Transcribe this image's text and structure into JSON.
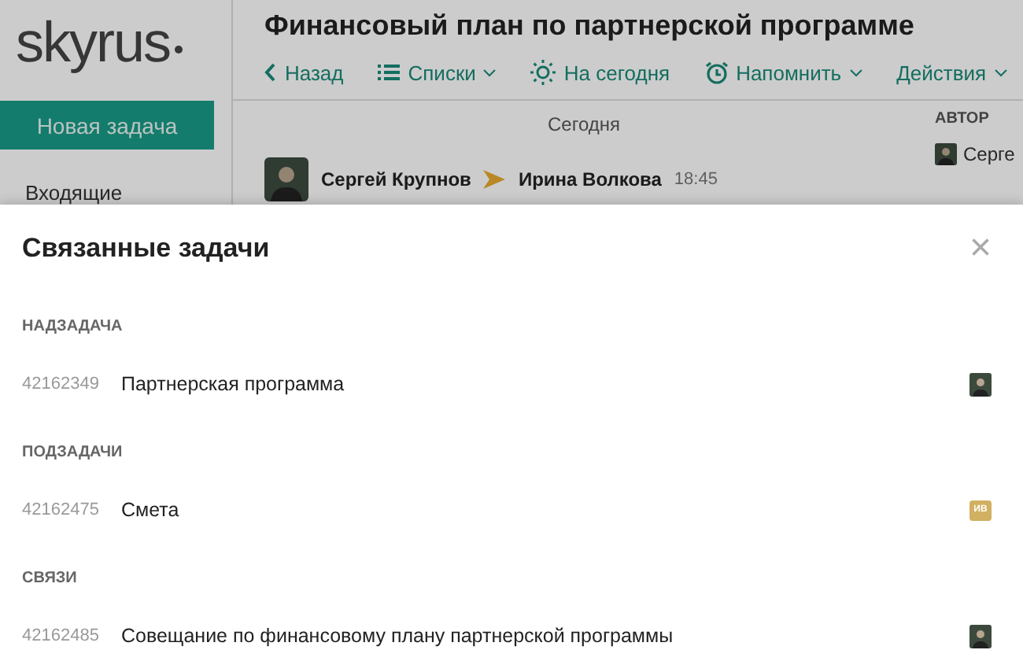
{
  "app": {
    "logo": "skyrus",
    "new_task_button": "Новая задача",
    "sidebar_items": [
      "Входящие"
    ],
    "task_title": "Финансовый план по партнерской программе",
    "toolbar": [
      {
        "kind": "back",
        "label": "Назад",
        "dropdown": false
      },
      {
        "kind": "list",
        "label": "Списки",
        "dropdown": true
      },
      {
        "kind": "sun",
        "label": "На сегодня",
        "dropdown": false
      },
      {
        "kind": "alarm",
        "label": "Напомнить",
        "dropdown": true
      },
      {
        "kind": "none",
        "label": "Действия",
        "dropdown": true
      }
    ],
    "day_label": "Сегодня",
    "author_heading": "АВТОР",
    "author_name": "Серге",
    "message": {
      "from": "Сергей Крупнов",
      "to": "Ирина Волкова",
      "time": "18:45"
    }
  },
  "dialog": {
    "title": "Связанные задачи",
    "close": "×",
    "sections": [
      {
        "heading": "НАДЗАДАЧА",
        "tasks": [
          {
            "id": "42162349",
            "name": "Партнерская программа",
            "avatar": {
              "kind": "photo"
            }
          }
        ]
      },
      {
        "heading": "ПОДЗАДАЧИ",
        "tasks": [
          {
            "id": "42162475",
            "name": "Смета",
            "avatar": {
              "kind": "initials",
              "text": "ИВ"
            }
          }
        ]
      },
      {
        "heading": "СВЯЗИ",
        "tasks": [
          {
            "id": "42162485",
            "name": "Совещание по финансовому плану партнерской программы",
            "avatar": {
              "kind": "photo"
            }
          }
        ]
      }
    ]
  }
}
